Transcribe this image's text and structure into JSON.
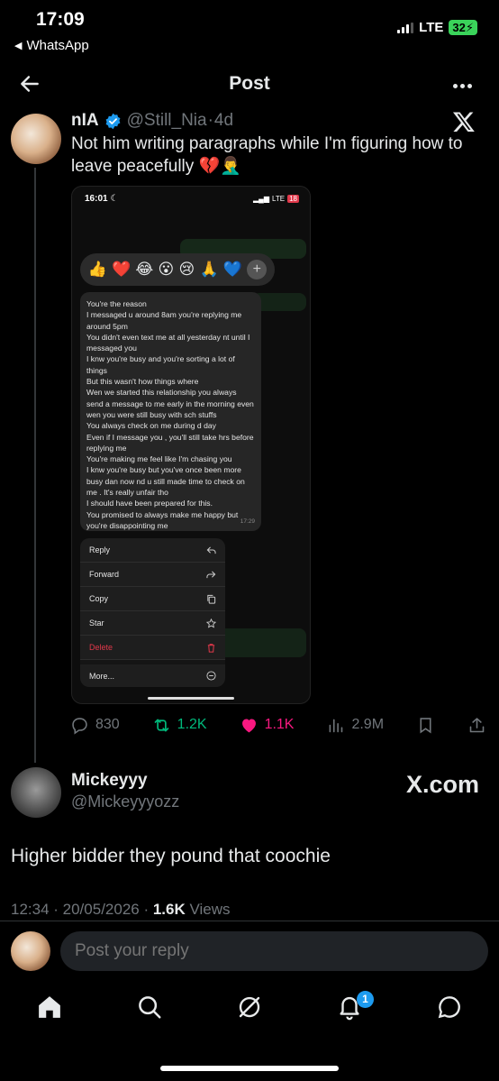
{
  "status_bar": {
    "time": "17:09",
    "back_app": "WhatsApp",
    "network": "LTE",
    "battery": "32"
  },
  "header": {
    "title": "Post",
    "back_icon": "back-arrow-icon",
    "more_icon": "more-icon"
  },
  "post": {
    "author_name": "nIA",
    "author_handle": "@Still_Nia",
    "age": "4d",
    "text": "Not him writing paragraphs while I'm figuring how to leave peacefully 💔🤦‍♂️",
    "media": {
      "time": "16:01",
      "network": "LTE",
      "battery": "18",
      "reactions": [
        "👍",
        "❤️",
        "😂",
        "😮",
        "😢",
        "🙏",
        "💙"
      ],
      "message_lines": [
        "You're the reason",
        "I messaged u around 8am you're replying me around 5pm",
        "You didn't even text me at all yesterday nt until I messaged you",
        "I knw you're busy and you're sorting a lot of things",
        "But this wasn't how things where",
        "Wen we started this relationship you always send a message to me early in the morning even wen you were still busy with sch stuffs",
        "You always check on me during d day",
        "Even if I message you , you'll still take hrs before replying me",
        "You're making me feel like I'm chasing you",
        "I knw you're busy but you've once been more busy dan now nd u still made time to check on me . It's really unfair tho",
        "I should have been prepared for this.",
        "You promised to always make me happy but you're disappointing me"
      ],
      "message_time": "17:29",
      "menu": [
        "Reply",
        "Forward",
        "Copy",
        "Star",
        "Delete",
        "More..."
      ]
    },
    "stats": {
      "replies": "830",
      "reposts": "1.2K",
      "likes": "1.1K",
      "views": "2.9M"
    }
  },
  "reply": {
    "name": "Mickeyyy",
    "handle": "@Mickeyyyozz",
    "watermark": "X.com",
    "text": "Higher bidder they pound that coochie",
    "time_date": "12:34 · 20/05/2026 · ",
    "views_count": "1.6K",
    "views_label": " Views"
  },
  "composer": {
    "placeholder": "Post your reply"
  },
  "nav": {
    "notifications_badge": "1"
  },
  "colors": {
    "accent": "#1d9bf0",
    "repost": "#00ba7c",
    "like": "#f91880",
    "muted": "#71767b"
  }
}
